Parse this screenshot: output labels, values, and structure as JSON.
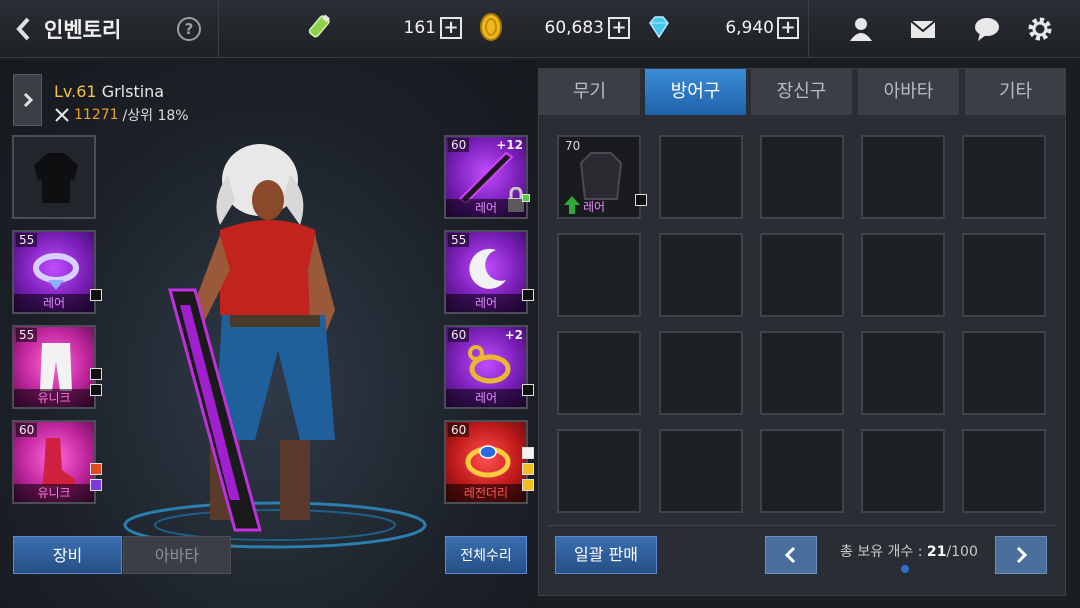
{
  "header": {
    "title": "인벤토리",
    "help": "?",
    "currencies": [
      {
        "icon": "stamina-potion-icon",
        "value": "161"
      },
      {
        "icon": "gold-coin-icon",
        "value": "60,683"
      },
      {
        "icon": "diamond-icon",
        "value": "6,940"
      }
    ],
    "plus": "+"
  },
  "character": {
    "level_prefix": "Lv.61",
    "name": "Grlstina",
    "power": "11271",
    "rank_text": "/상위 18%"
  },
  "left_slots": [
    {
      "level": "",
      "rarity": "",
      "enhance": ""
    },
    {
      "level": "55",
      "rarity": "레어",
      "enhance": ""
    },
    {
      "level": "55",
      "rarity": "유니크",
      "enhance": ""
    },
    {
      "level": "60",
      "rarity": "유니크",
      "enhance": ""
    }
  ],
  "right_slots": [
    {
      "level": "60",
      "rarity": "레어",
      "enhance": "+12"
    },
    {
      "level": "55",
      "rarity": "레어",
      "enhance": ""
    },
    {
      "level": "60",
      "rarity": "레어",
      "enhance": "+2"
    },
    {
      "level": "60",
      "rarity": "레전더리",
      "enhance": ""
    }
  ],
  "left_buttons": {
    "equip": "장비",
    "avatar": "아바타",
    "repair": "전체수리"
  },
  "tabs": [
    "무기",
    "방어구",
    "장신구",
    "아바타",
    "기타"
  ],
  "active_tab": "방어구",
  "inventory_item": {
    "level": "70",
    "rarity": "레어"
  },
  "footer": {
    "sell": "일괄 판매",
    "count_label": "총 보유 개수 : ",
    "count_current": "21",
    "count_total": "/100"
  },
  "colors": {
    "rare": "#e58cff",
    "unique": "#ff7ad8",
    "legendary": "#ff5a5a",
    "accent": "#2f84d8"
  }
}
